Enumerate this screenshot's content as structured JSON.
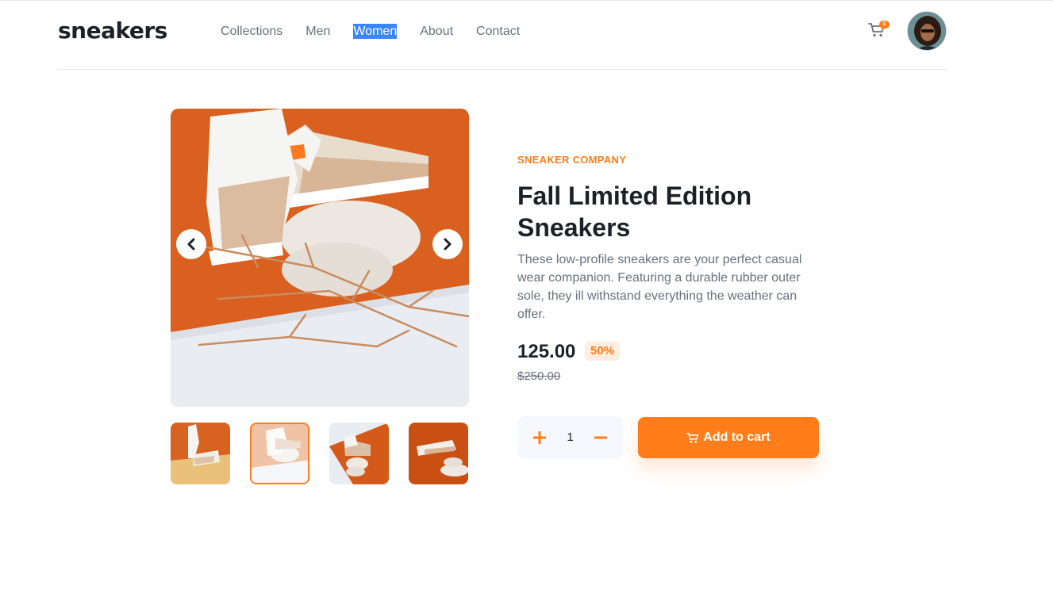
{
  "header": {
    "logo": "sneakers",
    "nav": [
      "Collections",
      "Men",
      "Women",
      "About",
      "Contact"
    ],
    "selected_nav": "Women",
    "cart_count": "0"
  },
  "product": {
    "company": "SNEAKER COMPANY",
    "title": "Fall Limited Edition Sneakers",
    "description": "These low-profile sneakers are your perfect casual wear companion. Featuring a durable rubber outer sole, they ill withstand everything the weather can offer.",
    "price": "125.00",
    "discount": "50%",
    "old_price": "$250.00",
    "quantity": "1",
    "add_to_cart": "Add to cart"
  },
  "gallery": {
    "thumbnail_count": 4,
    "active_thumbnail": 2
  },
  "colors": {
    "accent": "#ff7e1b",
    "accent_light": "#ffede0",
    "text_dark": "#1d2026",
    "text_grey": "#68707d"
  },
  "icons": [
    "cart-icon",
    "chevron-left-icon",
    "chevron-right-icon",
    "plus-icon",
    "minus-icon"
  ]
}
